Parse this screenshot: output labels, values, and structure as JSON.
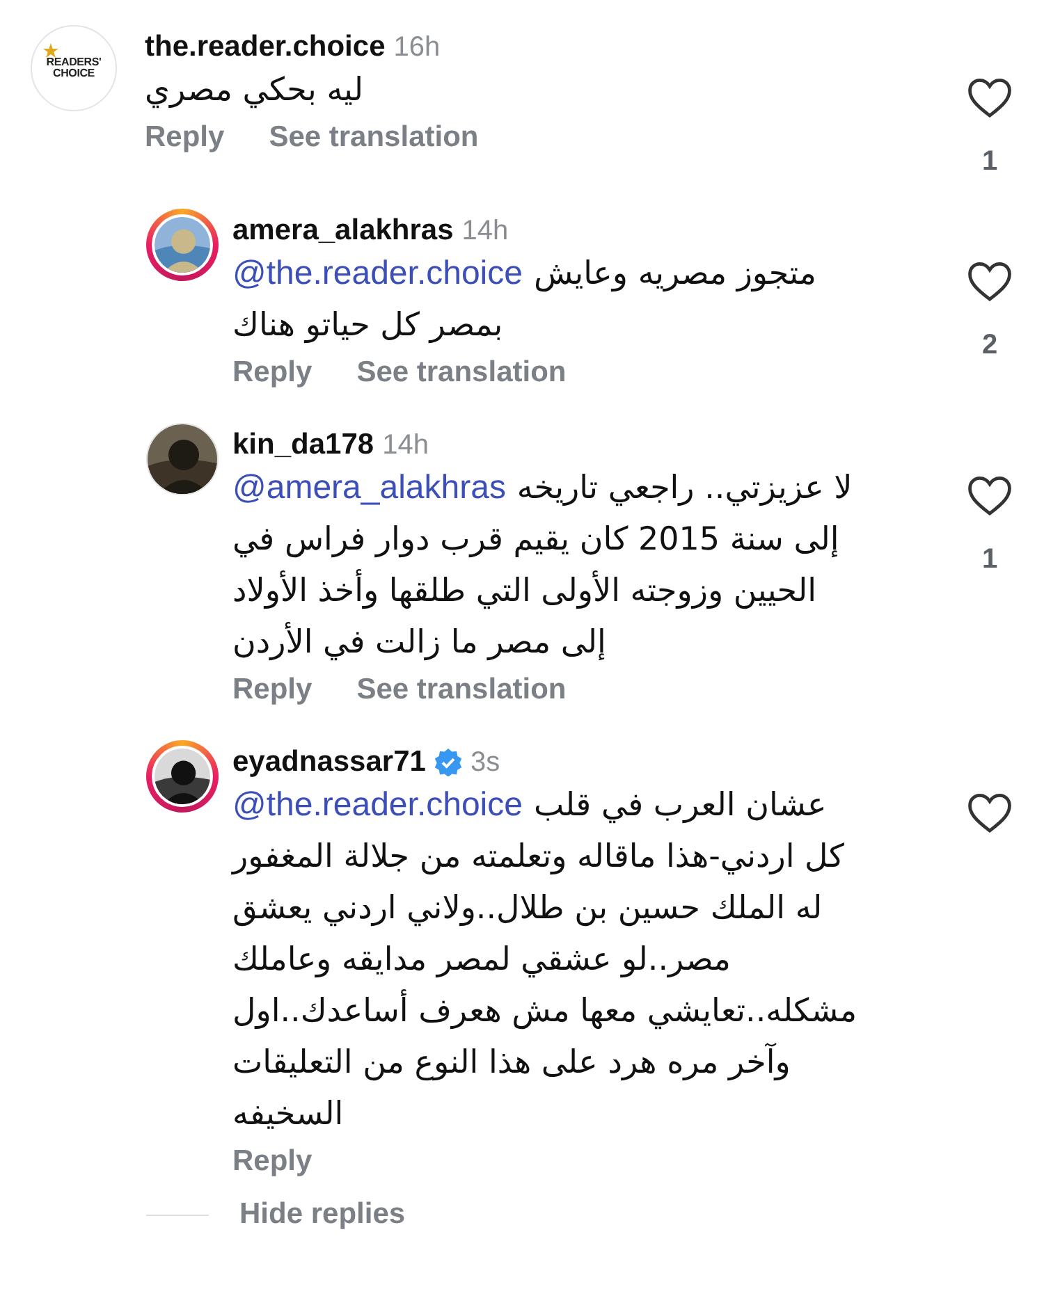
{
  "comments": [
    {
      "username": "the.reader.choice",
      "time": "16h",
      "verified": false,
      "avatar": {
        "kind": "logo",
        "logo_text": [
          "READERS'",
          "CHOICE"
        ]
      },
      "story_ring": false,
      "lines": [
        {
          "text": "ليه بحكي مصري"
        }
      ],
      "reply": "Reply",
      "translation": "See translation",
      "likes": "1"
    },
    {
      "username": "amera_alakhras",
      "time": "14h",
      "verified": false,
      "story_ring": true,
      "lines": [
        {
          "mention": "@the.reader.choice",
          "text": "متجوز مصريه وعايش"
        },
        {
          "text": "بمصر كل حياتو هناك"
        }
      ],
      "reply": "Reply",
      "translation": "See translation",
      "likes": "2"
    },
    {
      "username": "kin_da178",
      "time": "14h",
      "verified": false,
      "story_ring": false,
      "lines": [
        {
          "mention": "@amera_alakhras",
          "text": "لا عزيزتي.. راجعي تاريخه"
        },
        {
          "text": "إلى سنة 2015 كان يقيم قرب دوار فراس في"
        },
        {
          "text": "الحيين وزوجته الأولى التي طلقها وأخذ الأولاد"
        },
        {
          "text": "إلى مصر ما زالت في الأردن"
        }
      ],
      "reply": "Reply",
      "translation": "See translation",
      "likes": "1"
    },
    {
      "username": "eyadnassar71",
      "time": "3s",
      "verified": true,
      "story_ring": true,
      "lines": [
        {
          "mention": "@the.reader.choice",
          "text": "عشان العرب في قلب"
        },
        {
          "text": "كل اردني-هذا ماقاله وتعلمته من جلالة المغفور"
        },
        {
          "text": "له الملك حسين بن طلال..ولاني اردني يعشق"
        },
        {
          "text": "مصر..لو عشقي لمصر مدايقه وعاملك"
        },
        {
          "text": "مشكله..تعايشي معها مش هعرف أساعدك..اول"
        },
        {
          "text": "وآخر مره هرد على هذا النوع من التعليقات"
        },
        {
          "text": "السخيفه"
        }
      ],
      "reply": "Reply"
    }
  ],
  "hide_replies": "Hide replies"
}
